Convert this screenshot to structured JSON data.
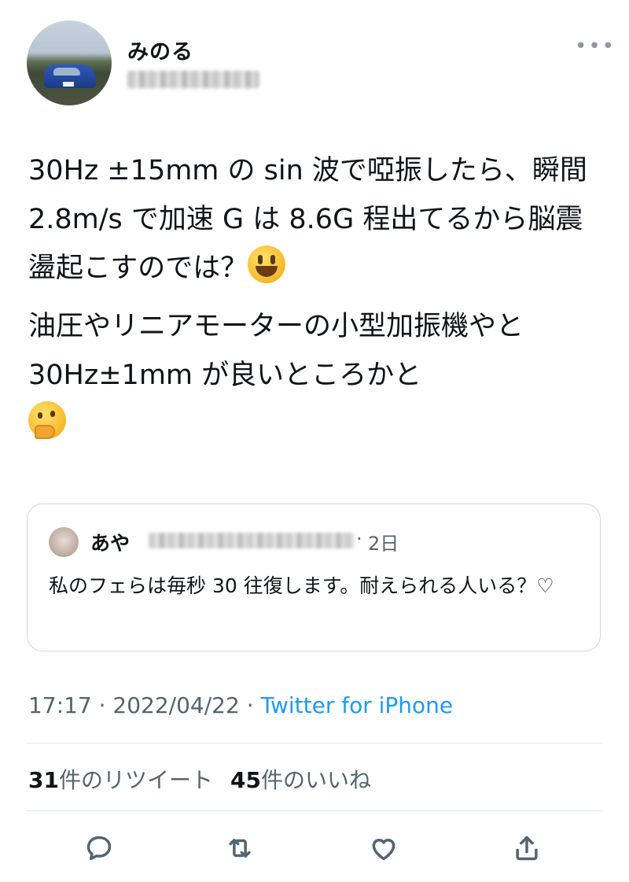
{
  "author": {
    "display_name": "みのる",
    "avatar_icon": "avatar-car-photo",
    "handle_blurred": true
  },
  "more_icon": "more-horizontal-icon",
  "tweet": {
    "paragraph1": "30Hz ±15mm の sin 波で啞振したら、瞬間 2.8m/s で加速 G は 8.6G 程出てるから脳震盪起こすのでは？",
    "paragraph1_emoji": "grinning-face-icon",
    "paragraph2": "油圧やリニアモーターの小型加振機やと 30Hz±1mm が良いところかと",
    "paragraph2_emoji": "thinking-face-icon"
  },
  "quote": {
    "display_name": "あや",
    "separator": "·",
    "time": "2日",
    "text": "私のフェらは毎秒 30 往復します。耐えられる人いる？♡"
  },
  "meta": {
    "time": "17:17",
    "dot1": " · ",
    "date": "2022/04/22",
    "dot2": " · ",
    "source": "Twitter for iPhone"
  },
  "stats": {
    "retweet_count": "31",
    "retweet_label": "件のリツイート",
    "like_count": "45",
    "like_label": "件のいいね"
  },
  "actions": {
    "reply_icon": "reply-icon",
    "retweet_icon": "retweet-icon",
    "like_icon": "heart-icon",
    "share_icon": "share-icon",
    "icon_color": "#536471"
  },
  "colors": {
    "link": "#1d9bf0",
    "secondary_text": "#536471",
    "border": "#cfd9de"
  }
}
